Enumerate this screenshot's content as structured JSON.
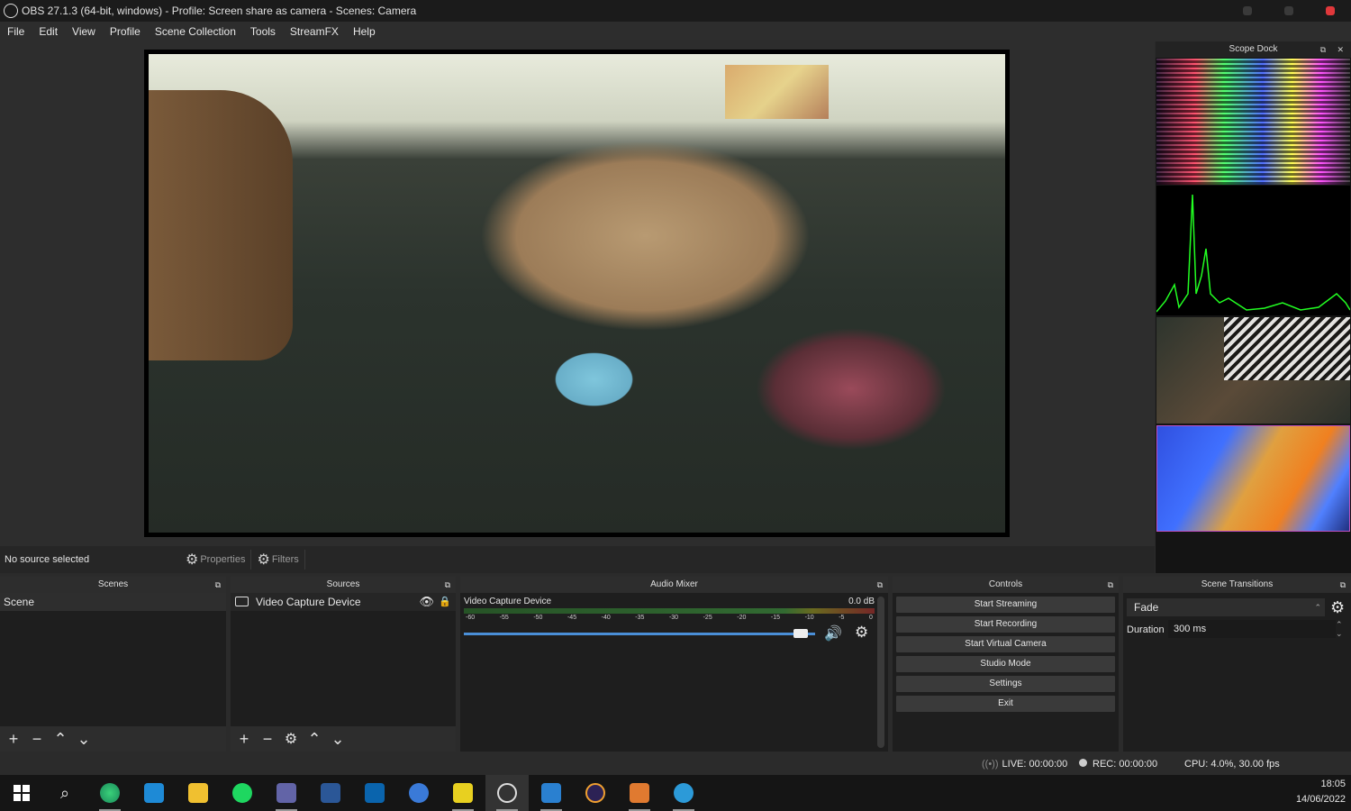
{
  "window": {
    "title": "OBS 27.1.3 (64-bit, windows) - Profile: Screen share as camera - Scenes: Camera"
  },
  "menu": [
    "File",
    "Edit",
    "View",
    "Profile",
    "Scene Collection",
    "Tools",
    "StreamFX",
    "Help"
  ],
  "scope_dock": {
    "title": "Scope Dock"
  },
  "selection_bar": {
    "no_source": "No source selected",
    "properties": "Properties",
    "filters": "Filters"
  },
  "scenes": {
    "title": "Scenes",
    "items": [
      "Scene"
    ]
  },
  "sources": {
    "title": "Sources",
    "items": [
      "Video Capture Device"
    ]
  },
  "mixer": {
    "title": "Audio Mixer",
    "channel": "Video Capture Device",
    "db": "0.0 dB",
    "ticks": [
      "-60",
      "-55",
      "-50",
      "-45",
      "-40",
      "-35",
      "-30",
      "-25",
      "-20",
      "-15",
      "-10",
      "-5",
      "0"
    ],
    "volume_fraction": 0.97
  },
  "controls": {
    "title": "Controls",
    "buttons": [
      "Start Streaming",
      "Start Recording",
      "Start Virtual Camera",
      "Studio Mode",
      "Settings",
      "Exit"
    ]
  },
  "transitions": {
    "title": "Scene Transitions",
    "selected": "Fade",
    "duration_label": "Duration",
    "duration_value": "300 ms"
  },
  "status": {
    "live": "LIVE: 00:00:00",
    "rec": "REC: 00:00:00",
    "cpu": "CPU: 4.0%, 30.00 fps"
  },
  "clock": {
    "time": "18:05",
    "date": "14/06/2022"
  },
  "colors": {
    "accent": "#4a8fd8",
    "close": "#e0383b"
  }
}
